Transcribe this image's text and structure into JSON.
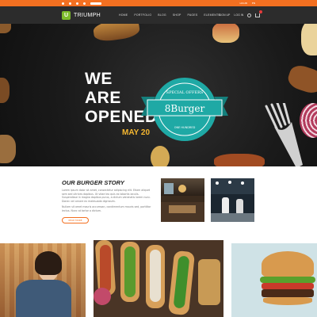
{
  "header": {
    "logo_mark": "U",
    "brand": "TRIUMPH",
    "nav": [
      "HOME",
      "PORTFOLIO",
      "BLOG",
      "SHOP",
      "PAGES",
      "ELEMENTS"
    ],
    "account": [
      "SIGN UP",
      "LOG IN"
    ]
  },
  "topbar": {
    "right_items": [
      "LOGIN",
      "EN"
    ]
  },
  "hero": {
    "title_lines": [
      "WE",
      "ARE",
      "OPENED"
    ],
    "date": "MAY 20",
    "badge": {
      "top": "SPECIAL OFFERS",
      "name": "8Burger",
      "bottom": "ONE HUNDRED"
    }
  },
  "story": {
    "title": "OUR BURGER STORY",
    "paragraph1": "Lorem ipsum dolor sit amet, consectetur adipiscing elit. Etiam aliquet sem sed ultrices dapibus. Ut vitae leo quis ex lobortis iaculis. Suspendisse in magna dapibus purus, a dictum venenatis lorem nunc. Donec vel ornare ex malesuada dignissim.",
    "paragraph2": "Nullam sit amet mauris accumsan, condimentum mauris sed, porttitor lectus. Nunc at tortor a dictum.",
    "button": "READ MORE"
  },
  "colors": {
    "accent": "#f37021",
    "badge_teal": "#1fa9a5",
    "date_gold": "#f5b731",
    "nav_bg": "#2c2c2c",
    "logo_green": "#7dbb2a"
  }
}
